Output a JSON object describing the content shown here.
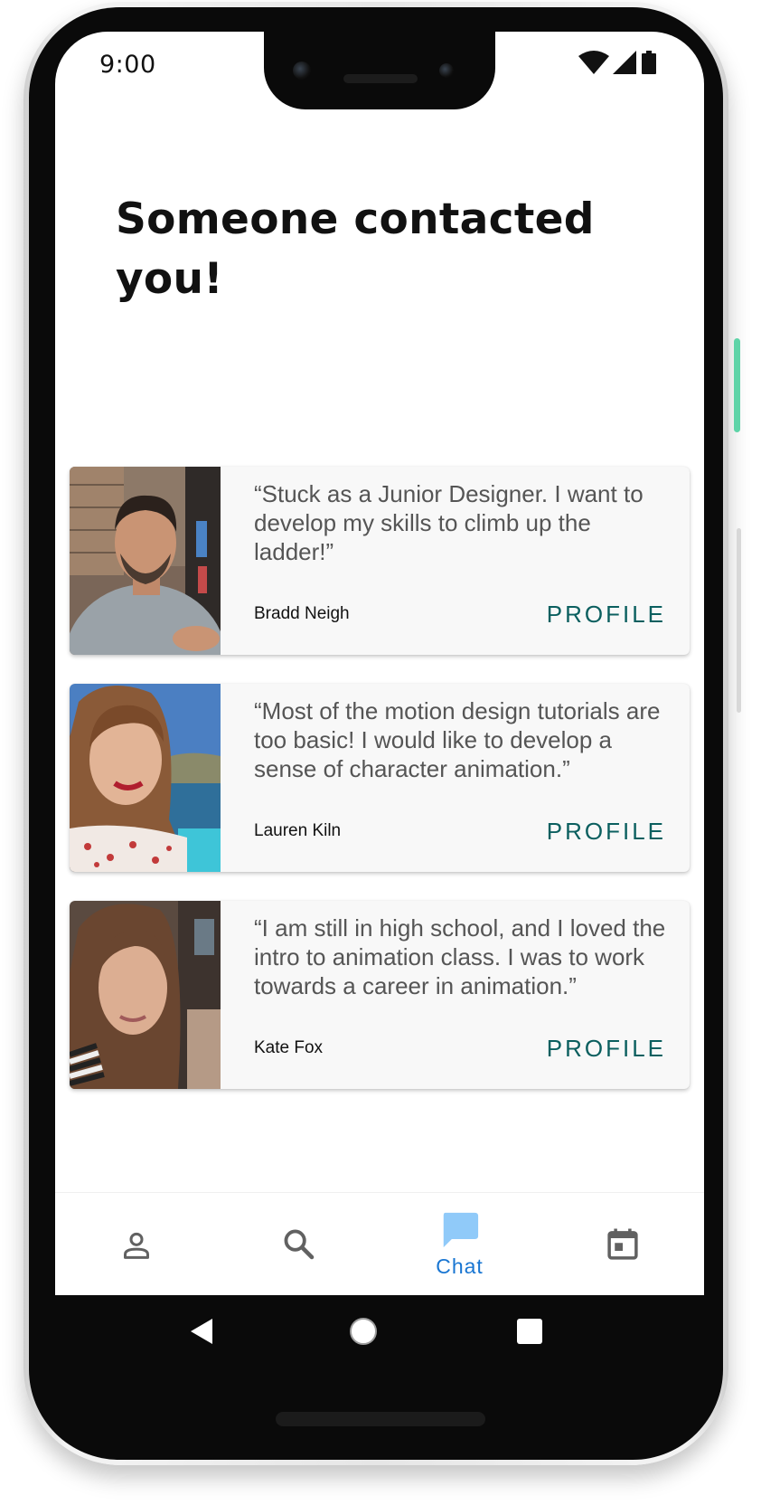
{
  "status_bar": {
    "time": "9:00",
    "icons": [
      "wifi-icon",
      "cell-signal-icon",
      "battery-icon"
    ]
  },
  "page": {
    "title": "Someone contacted you!"
  },
  "cards": [
    {
      "quote": "“Stuck as a Junior Designer. I want to develop my skills to climb up the ladder!”",
      "name": "Bradd Neigh",
      "action": "PROFILE"
    },
    {
      "quote": "“Most of the motion design tutorials are too basic! I would like to develop a sense of character animation.”",
      "name": "Lauren Kiln",
      "action": "PROFILE"
    },
    {
      "quote": "“I am still in high school, and I loved the intro to animation class. I was to work towards a career in animation.”",
      "name": "Kate Fox",
      "action": "PROFILE"
    }
  ],
  "bottom_nav": {
    "items": [
      {
        "icon": "person-icon",
        "label": ""
      },
      {
        "icon": "search-icon",
        "label": ""
      },
      {
        "icon": "chat-icon",
        "label": "Chat",
        "active": true
      },
      {
        "icon": "calendar-icon",
        "label": ""
      }
    ]
  },
  "system_nav": [
    "back-icon",
    "home-icon",
    "recents-icon"
  ],
  "colors": {
    "accent": "#1976d2",
    "chat_icon": "#90caf9",
    "profile_link": "#0b5f5f",
    "nav_icon": "#616161",
    "card_bg": "#f8f8f8"
  }
}
